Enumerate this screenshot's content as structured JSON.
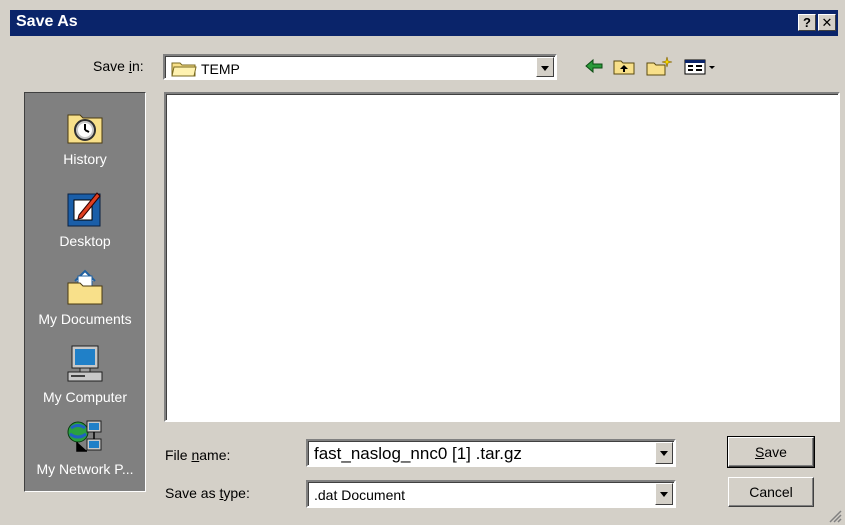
{
  "window": {
    "title": "Save As",
    "help_label": "?",
    "close_label": "✕"
  },
  "save_in": {
    "label_pre": "Save ",
    "label_key": "i",
    "label_post": "n:",
    "value": "TEMP"
  },
  "toolbar": {
    "back": "back-arrow-icon",
    "up": "up-folder-icon",
    "new_folder": "new-folder-icon",
    "view": "view-menu-icon"
  },
  "places": [
    {
      "label": "History",
      "icon": "history-icon"
    },
    {
      "label": "Desktop",
      "icon": "desktop-icon"
    },
    {
      "label": "My Documents",
      "icon": "my-documents-icon"
    },
    {
      "label": "My Computer",
      "icon": "my-computer-icon"
    },
    {
      "label": "My Network P...",
      "icon": "network-places-icon"
    }
  ],
  "file_name": {
    "label_pre": "File ",
    "label_key": "n",
    "label_post": "ame:",
    "value": "fast_naslog_nnc0 [1] .tar.gz"
  },
  "save_as_type": {
    "label_pre": "Save as ",
    "label_key": "t",
    "label_post": "ype:",
    "value": ".dat Document"
  },
  "buttons": {
    "save_key": "S",
    "save_rest": "ave",
    "cancel": "Cancel"
  },
  "colors": {
    "title_bar": "#0a246a",
    "face": "#d4d0c8",
    "places_bg": "#808080"
  }
}
